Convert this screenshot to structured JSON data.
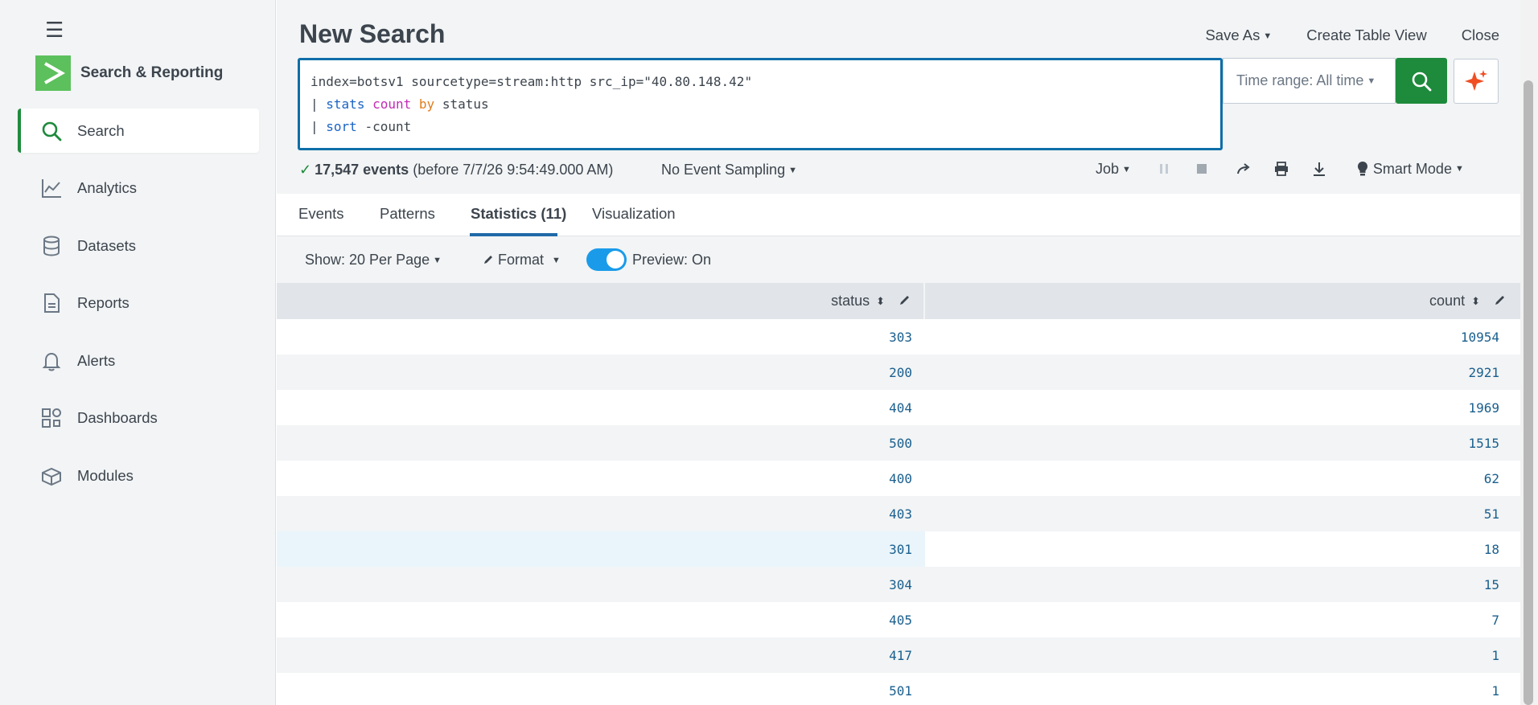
{
  "sidebar": {
    "brand": "Search & Reporting",
    "items": [
      {
        "label": "Search",
        "icon": "search-icon"
      },
      {
        "label": "Analytics",
        "icon": "analytics-icon"
      },
      {
        "label": "Datasets",
        "icon": "datasets-icon"
      },
      {
        "label": "Reports",
        "icon": "reports-icon"
      },
      {
        "label": "Alerts",
        "icon": "bell-icon"
      },
      {
        "label": "Dashboards",
        "icon": "dashboards-icon"
      },
      {
        "label": "Modules",
        "icon": "modules-icon"
      }
    ],
    "active": "Search"
  },
  "header": {
    "title": "New Search",
    "save_as": "Save As",
    "create_table_view": "Create Table View",
    "close": "Close"
  },
  "search": {
    "line1": "index=botsv1 sourcetype=stream:http src_ip=\"40.80.148.42\"",
    "line2_pipe": "|",
    "line2_cmd": "stats",
    "line2_func": "count",
    "line2_by": "by",
    "line2_field": "status",
    "line3_pipe": "|",
    "line3_cmd": "sort",
    "line3_arg": "-count",
    "time_range": "Time range: All time"
  },
  "status": {
    "events_count": "17,547 events",
    "before_text": "(before 7/7/26 9:54:49.000 AM)",
    "sampling": "No Event Sampling",
    "job": "Job",
    "mode": "Smart Mode"
  },
  "tabs": [
    {
      "label": "Events"
    },
    {
      "label": "Patterns"
    },
    {
      "label": "Statistics (11)"
    },
    {
      "label": "Visualization"
    }
  ],
  "active_tab": "Statistics (11)",
  "toolbar": {
    "show": "Show: 20 Per Page",
    "format": "Format",
    "preview": "Preview: On",
    "preview_on": true
  },
  "table": {
    "columns": [
      "status",
      "count"
    ],
    "rows": [
      [
        "303",
        "10954"
      ],
      [
        "200",
        "2921"
      ],
      [
        "404",
        "1969"
      ],
      [
        "500",
        "1515"
      ],
      [
        "400",
        "62"
      ],
      [
        "403",
        "51"
      ],
      [
        "301",
        "18"
      ],
      [
        "304",
        "15"
      ],
      [
        "405",
        "7"
      ],
      [
        "417",
        "1"
      ],
      [
        "501",
        "1"
      ]
    ]
  },
  "colors": {
    "accent_green": "#1e8a3c",
    "focus_blue": "#0e6ea8",
    "toggle_blue": "#1a9bea",
    "cell_text": "#1a5f8e"
  }
}
